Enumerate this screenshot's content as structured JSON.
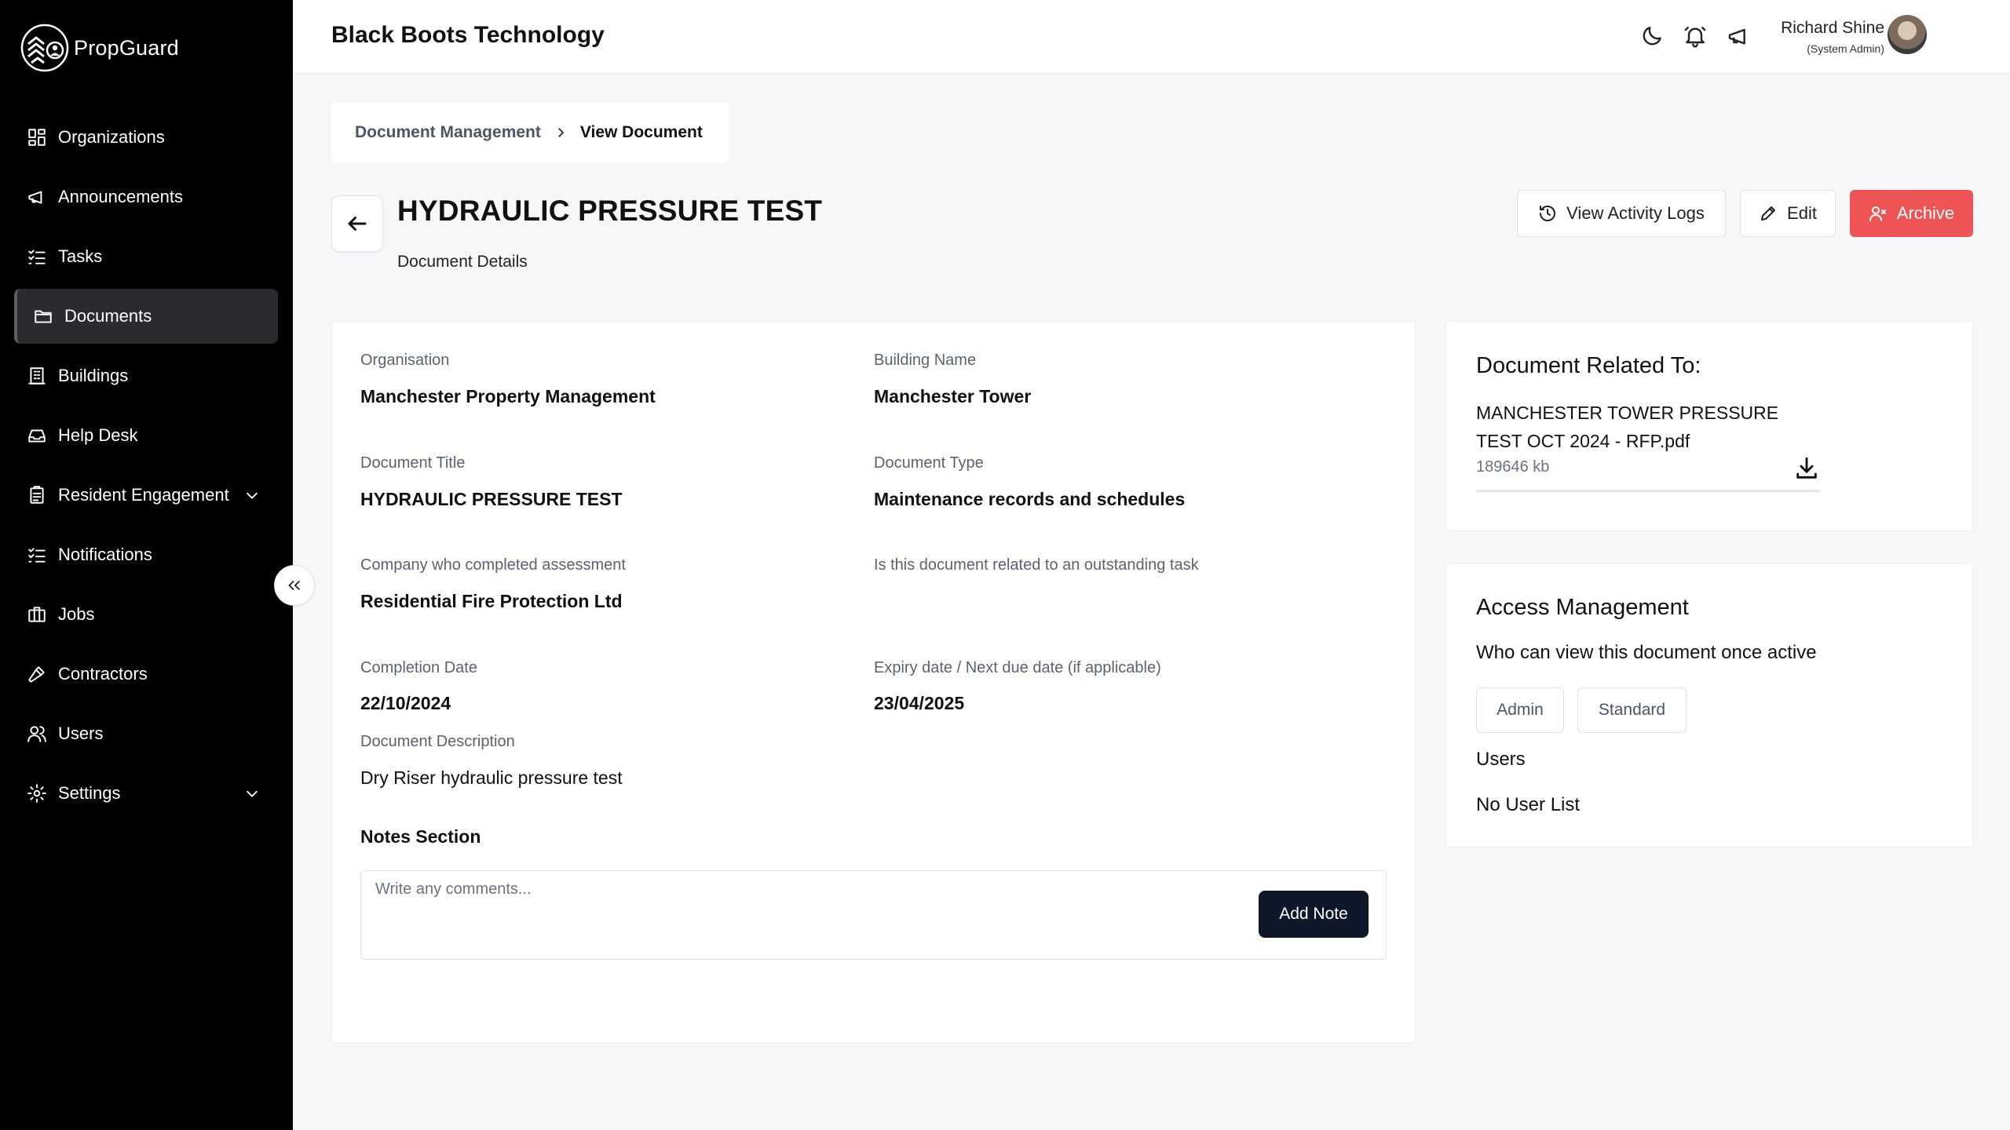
{
  "app": {
    "name": "PropGuard"
  },
  "sidebar": {
    "items": [
      {
        "label": "Organizations",
        "icon": "grid-icon"
      },
      {
        "label": "Announcements",
        "icon": "megaphone-icon"
      },
      {
        "label": "Tasks",
        "icon": "list-check-icon"
      },
      {
        "label": "Documents",
        "icon": "folder-icon",
        "active": true
      },
      {
        "label": "Buildings",
        "icon": "building-icon"
      },
      {
        "label": "Help Desk",
        "icon": "inbox-icon"
      },
      {
        "label": "Resident Engagement",
        "icon": "clipboard-icon",
        "expandable": true
      },
      {
        "label": "Notifications",
        "icon": "list-check-icon"
      },
      {
        "label": "Jobs",
        "icon": "briefcase-icon"
      },
      {
        "label": "Contractors",
        "icon": "hammer-icon"
      },
      {
        "label": "Users",
        "icon": "users-icon"
      },
      {
        "label": "Settings",
        "icon": "gear-icon",
        "expandable": true
      }
    ]
  },
  "header": {
    "org_title": "Black Boots Technology",
    "user_name": "Richard Shine",
    "user_role": "(System Admin)"
  },
  "breadcrumb": {
    "parent": "Document Management",
    "current": "View Document"
  },
  "document": {
    "title": "HYDRAULIC PRESSURE TEST",
    "subtitle": "Document Details",
    "actions": {
      "activity": "View Activity Logs",
      "edit": "Edit",
      "archive": "Archive"
    },
    "fields": {
      "organisation_label": "Organisation",
      "organisation_value": "Manchester Property Management",
      "building_label": "Building Name",
      "building_value": "Manchester Tower",
      "doc_title_label": "Document Title",
      "doc_title_value": "HYDRAULIC PRESSURE TEST",
      "doc_type_label": "Document Type",
      "doc_type_value": "Maintenance records and schedules",
      "company_label": "Company who completed assessment",
      "company_value": "Residential Fire Protection Ltd",
      "task_label": "Is this document related to an outstanding task",
      "completion_label": "Completion Date",
      "completion_value": "22/10/2024",
      "expiry_label": "Expiry date / Next due date (if applicable)",
      "expiry_value": "23/04/2025",
      "description_label": "Document Description",
      "description_value": "Dry Riser hydraulic pressure test"
    },
    "notes": {
      "title": "Notes Section",
      "placeholder": "Write any comments...",
      "button": "Add Note"
    }
  },
  "related": {
    "heading": "Document Related To:",
    "file_name": "MANCHESTER TOWER PRESSURE TEST OCT 2024 - RFP.pdf",
    "file_size": "189646 kb"
  },
  "access": {
    "heading": "Access Management",
    "description": "Who can view this document once active",
    "roles": [
      "Admin",
      "Standard"
    ],
    "users_label": "Users",
    "users_value": "No User List"
  },
  "colors": {
    "sidebar_bg": "#000000",
    "archive": "#ef5454",
    "primary_button": "#0f172a"
  }
}
